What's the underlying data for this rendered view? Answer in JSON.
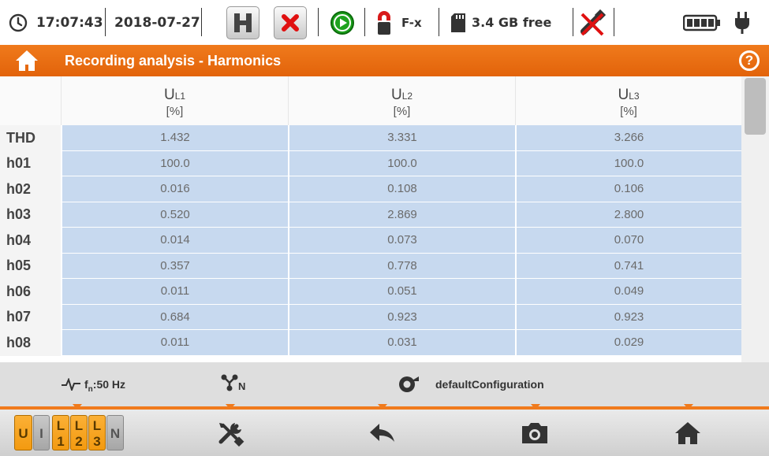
{
  "status": {
    "time": "17:07:43",
    "date": "2018-07-27",
    "clamp_label": "F-x",
    "storage": "3.4 GB free"
  },
  "titlebar": {
    "title": "Recording analysis - Harmonics",
    "help": "?"
  },
  "table": {
    "columns": [
      {
        "name": "U",
        "sub": "L1",
        "unit": "[%]"
      },
      {
        "name": "U",
        "sub": "L2",
        "unit": "[%]"
      },
      {
        "name": "U",
        "sub": "L3",
        "unit": "[%]"
      }
    ],
    "rows": [
      {
        "label": "THD",
        "values": [
          "1.432",
          "3.331",
          "3.266"
        ]
      },
      {
        "label": "h01",
        "values": [
          "100.0",
          "100.0",
          "100.0"
        ]
      },
      {
        "label": "h02",
        "values": [
          "0.016",
          "0.108",
          "0.106"
        ]
      },
      {
        "label": "h03",
        "values": [
          "0.520",
          "2.869",
          "2.800"
        ]
      },
      {
        "label": "h04",
        "values": [
          "0.014",
          "0.073",
          "0.070"
        ]
      },
      {
        "label": "h05",
        "values": [
          "0.357",
          "0.778",
          "0.741"
        ]
      },
      {
        "label": "h06",
        "values": [
          "0.011",
          "0.051",
          "0.049"
        ]
      },
      {
        "label": "h07",
        "values": [
          "0.684",
          "0.923",
          "0.923"
        ]
      },
      {
        "label": "h08",
        "values": [
          "0.011",
          "0.031",
          "0.029"
        ]
      }
    ]
  },
  "infobar": {
    "frequency_prefix": "f",
    "frequency_sub": "n",
    "frequency_value": ":50 Hz",
    "network_sub": "N",
    "config": "defaultConfiguration"
  },
  "bottombar": {
    "u_key": "U",
    "i_key": "I",
    "l1_top": "L",
    "l1_bottom": "1",
    "l2_top": "L",
    "l2_bottom": "2",
    "l3_top": "L",
    "l3_bottom": "3",
    "n_key": "N"
  },
  "colors": {
    "accent": "#f07a1c",
    "cell": "#c7d9ef",
    "key_active": "#f39a10"
  }
}
